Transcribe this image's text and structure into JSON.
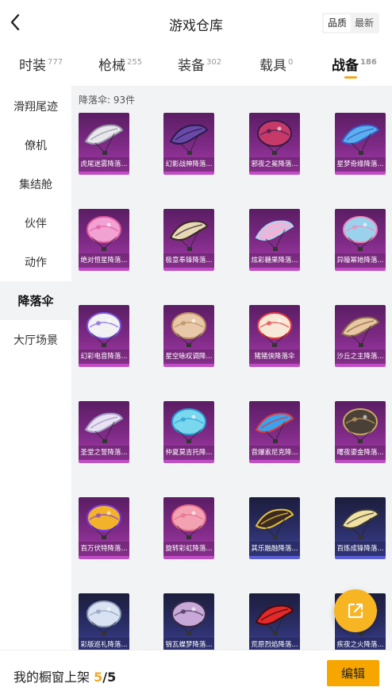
{
  "header": {
    "title": "游戏仓库",
    "back_icon": "chevron-left-icon",
    "sort": [
      "品质",
      "最新"
    ],
    "sort_active": "品质"
  },
  "tabs": [
    {
      "label": "时装",
      "count": "777"
    },
    {
      "label": "枪械",
      "count": "255"
    },
    {
      "label": "装备",
      "count": "302"
    },
    {
      "label": "载具",
      "count": "0"
    },
    {
      "label": "战备",
      "count": "186",
      "active": true
    }
  ],
  "sidebar": [
    {
      "label": "滑翔尾迹"
    },
    {
      "label": "僚机"
    },
    {
      "label": "集结舱"
    },
    {
      "label": "伙伴"
    },
    {
      "label": "动作"
    },
    {
      "label": "降落伞",
      "active": true
    },
    {
      "label": "大厅场景"
    }
  ],
  "main": {
    "count_label": "降落伞: 93件"
  },
  "items": [
    {
      "name": "虎尾迷雾降落...",
      "rarity": "purple",
      "shape": "glider",
      "colors": [
        "#e8e8ec",
        "#9a9aa8"
      ]
    },
    {
      "name": "幻影战神降落...",
      "rarity": "purple",
      "shape": "glider",
      "colors": [
        "#6a4aa8",
        "#2a1a4a"
      ]
    },
    {
      "name": "邪夜之冕降落...",
      "rarity": "purple",
      "shape": "round",
      "colors": [
        "#c63a6a",
        "#3a1a4a"
      ]
    },
    {
      "name": "星梦奇缘降落...",
      "rarity": "purple",
      "shape": "glider",
      "colors": [
        "#5ab0ee",
        "#3a5ac8"
      ]
    },
    {
      "name": "绝对恒星降落...",
      "rarity": "purple",
      "shape": "round",
      "colors": [
        "#f2a2d2",
        "#e05aa0"
      ]
    },
    {
      "name": "极意奉锋降落...",
      "rarity": "purple",
      "shape": "glider",
      "colors": [
        "#e8d8b8",
        "#3a2a22"
      ]
    },
    {
      "name": "炫彩糖果降落...",
      "rarity": "purple",
      "shape": "glider",
      "colors": [
        "#f2b2d8",
        "#a2d8f2"
      ]
    },
    {
      "name": "异瞳幂她降落...",
      "rarity": "purple",
      "shape": "round",
      "colors": [
        "#9ad2ee",
        "#ee8ab8"
      ]
    },
    {
      "name": "幻彩电音降落...",
      "rarity": "purple",
      "shape": "round",
      "colors": [
        "#f2f2f2",
        "#7a5ae2"
      ]
    },
    {
      "name": "星空咏叹调降...",
      "rarity": "purple",
      "shape": "round",
      "colors": [
        "#e8c8a8",
        "#b88a62"
      ]
    },
    {
      "name": "猪猪侠降落伞",
      "rarity": "purple",
      "shape": "round",
      "colors": [
        "#f8e8d8",
        "#e23a3a"
      ]
    },
    {
      "name": "沙丘之主降落...",
      "rarity": "purple",
      "shape": "glider",
      "colors": [
        "#e8c8a2",
        "#8a6a4a"
      ]
    },
    {
      "name": "圣堂之誓降落...",
      "rarity": "purple",
      "shape": "glider",
      "colors": [
        "#e8e2f2",
        "#a298c2"
      ]
    },
    {
      "name": "仲夏莫吉托降...",
      "rarity": "purple",
      "shape": "round",
      "colors": [
        "#7ad8ee",
        "#2a9ad2"
      ]
    },
    {
      "name": "音爆索尼克降...",
      "rarity": "purple",
      "shape": "glider",
      "colors": [
        "#3aa2ee",
        "#e23a3a"
      ]
    },
    {
      "name": "曙夜鎏金降落...",
      "rarity": "purple",
      "shape": "round",
      "colors": [
        "#4a4038",
        "#c8a862"
      ]
    },
    {
      "name": "百万伏特降落...",
      "rarity": "purple",
      "shape": "round",
      "colors": [
        "#f2b22a",
        "#7a3ae2"
      ]
    },
    {
      "name": "旋转彩虹降落...",
      "rarity": "purple",
      "shape": "round",
      "colors": [
        "#f2a2b2",
        "#e86a8a"
      ]
    },
    {
      "name": "其乐融融降落...",
      "rarity": "blue",
      "shape": "glider",
      "colors": [
        "#3a2a22",
        "#e8c23a"
      ]
    },
    {
      "name": "百炼成锋降落...",
      "rarity": "blue",
      "shape": "glider",
      "colors": [
        "#f2e2a2",
        "#3a3a3a"
      ]
    },
    {
      "name": "彩版巡礼降落...",
      "rarity": "blue",
      "shape": "round",
      "colors": [
        "#d8e2f2",
        "#8a9ab8"
      ]
    },
    {
      "name": "锦瓦蝶梦降落...",
      "rarity": "blue",
      "shape": "round",
      "colors": [
        "#c8a8d8",
        "#3a2a4a"
      ]
    },
    {
      "name": "荒原烈焰降落...",
      "rarity": "blue",
      "shape": "glider",
      "colors": [
        "#e22a2a",
        "#4a0a0a"
      ]
    },
    {
      "name": "疾夜之火降落...",
      "rarity": "blue",
      "shape": "glider",
      "colors": [
        "#e8e8e8",
        "#2a2a3a"
      ]
    }
  ],
  "fab": {
    "icon": "share-external-icon"
  },
  "bottom": {
    "showcase_label": "我的橱窗上架",
    "current": "5",
    "separator": "/",
    "total": "5",
    "edit_label": "编辑"
  }
}
